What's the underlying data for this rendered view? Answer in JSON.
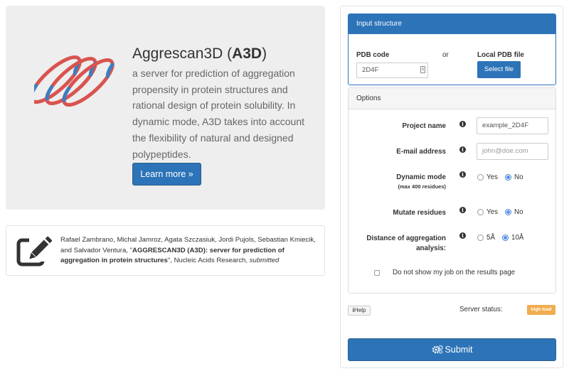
{
  "hero": {
    "title_prefix": "Aggrescan3D (",
    "title_bold": "A3D",
    "title_suffix": ")",
    "description": "a server for prediction of aggregation propensity in protein structures and rational design of protein solubility. In dynamic mode, A3D takes into account the flexibility of natural and designed polypeptides.",
    "learn_more_label": "Learn more »",
    "logo_colors": {
      "red": "#d9534f",
      "blue": "#3a7ec2"
    }
  },
  "citation": {
    "authors": "Rafael Zambrano, Michal Jamroz, Agata Szczasiuk, Jordi Pujols, Sebastian Kmiecik, and Salvador Ventura, \"",
    "paper_title": "AGGRESCAN3D (A3D): server for prediction of aggregation in protein structures",
    "journal": "\", Nucleic Acids Research, ",
    "status": "submitted",
    "icon": "edit-icon"
  },
  "input_structure": {
    "header": "Input structure",
    "pdb_code_label": "PDB code",
    "or_label": "or",
    "local_file_label": "Local PDB file",
    "pdb_code_value": "2D4F",
    "select_file_label": "Select file"
  },
  "options": {
    "header": "Options",
    "project_name_label": "Project name",
    "project_name_value": "example_2D4F",
    "email_label": "E-mail address",
    "email_placeholder": "john@doe.com",
    "dynamic_mode_label": "Dynamic mode",
    "dynamic_mode_sub": "(max 400 residues)",
    "dynamic_yes": "Yes",
    "dynamic_no": "No",
    "dynamic_selected": "No",
    "mutate_label": "Mutate residues",
    "mutate_yes": "Yes",
    "mutate_no": "No",
    "mutate_selected": "No",
    "distance_label_1": "Distance of aggregation",
    "distance_label_2": "analysis:",
    "distance_5": "5Å",
    "distance_10": "10Å",
    "distance_selected": "10Å",
    "hide_job_label": "Do not show my job on the results page",
    "hide_job_checked": false
  },
  "footer": {
    "help_label": "Help",
    "server_status_label": "Server status:",
    "server_status_value": "high load",
    "status_color": "#f0ad4e",
    "submit_label": "Submit"
  },
  "colors": {
    "primary": "#2d73b8",
    "hero_bg": "#eeeeee"
  }
}
